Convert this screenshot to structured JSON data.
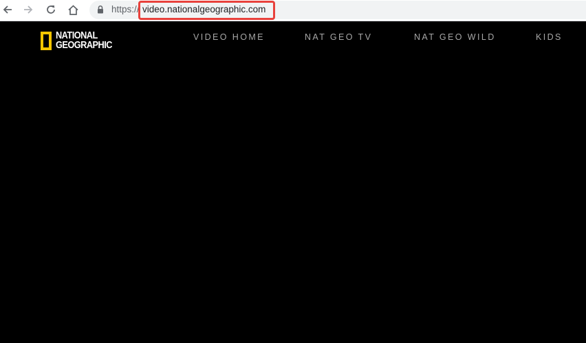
{
  "browser": {
    "url_scheme": "https://",
    "url_host": "video.nationalgeographic.com",
    "icons": [
      "back-icon",
      "forward-icon",
      "reload-icon",
      "home-icon",
      "lock-icon"
    ],
    "highlight_color": "#e8413c"
  },
  "header": {
    "logo": {
      "line1": "NATIONAL",
      "line2": "GEOGRAPHIC",
      "frame_color": "#f8c600"
    },
    "nav": [
      "VIDEO HOME",
      "NAT GEO TV",
      "NAT GEO WILD",
      "KIDS"
    ]
  },
  "colors": {
    "page_background": "#000000",
    "nav_text": "#a8a8a8"
  }
}
